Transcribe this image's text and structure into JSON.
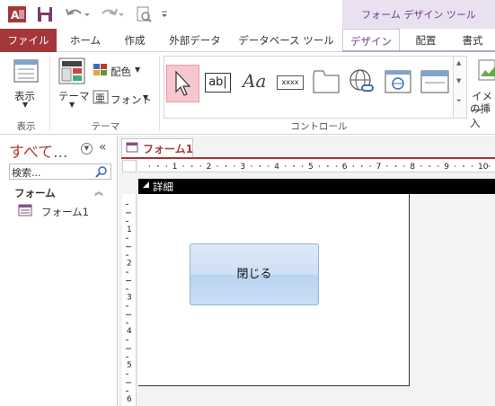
{
  "context_tab_group": "フォーム デザイン ツール",
  "tabs": [
    "ファイル",
    "ホーム",
    "作成",
    "外部データ",
    "データベース ツール",
    "デザイン",
    "配置",
    "書式"
  ],
  "ribbon": {
    "view": {
      "button_label": "表示",
      "group_label": "表示"
    },
    "theme": {
      "theme_label": "テーマ",
      "colors_label": "配色",
      "fonts_label": "フォント",
      "group_label": "テーマ"
    },
    "controls": {
      "group_label": "コントロール",
      "textbox_icon_text": "ab|",
      "label_icon_text": "Aa",
      "combo_icon_text": "xxxx"
    },
    "insert_image_label_1": "イメー",
    "insert_image_label_2": "の挿入"
  },
  "nav": {
    "title": "すべて...",
    "search_placeholder": "検索...",
    "section": "フォーム",
    "items": [
      "フォーム1"
    ]
  },
  "document": {
    "tab_label": "フォーム1",
    "section_label": "詳細",
    "button_caption": "閉じる",
    "hruler_numbers": [
      "1",
      "2",
      "3",
      "4",
      "5",
      "6",
      "7",
      "8",
      "9",
      "10"
    ],
    "vruler_numbers": [
      "1",
      "2",
      "3",
      "4",
      "5",
      "6"
    ]
  },
  "colors": {
    "file_tab": "#a4373a",
    "context_band": "#e9e1f0",
    "context_text": "#6a3d8b",
    "button_fill": "#cfe0f5"
  }
}
